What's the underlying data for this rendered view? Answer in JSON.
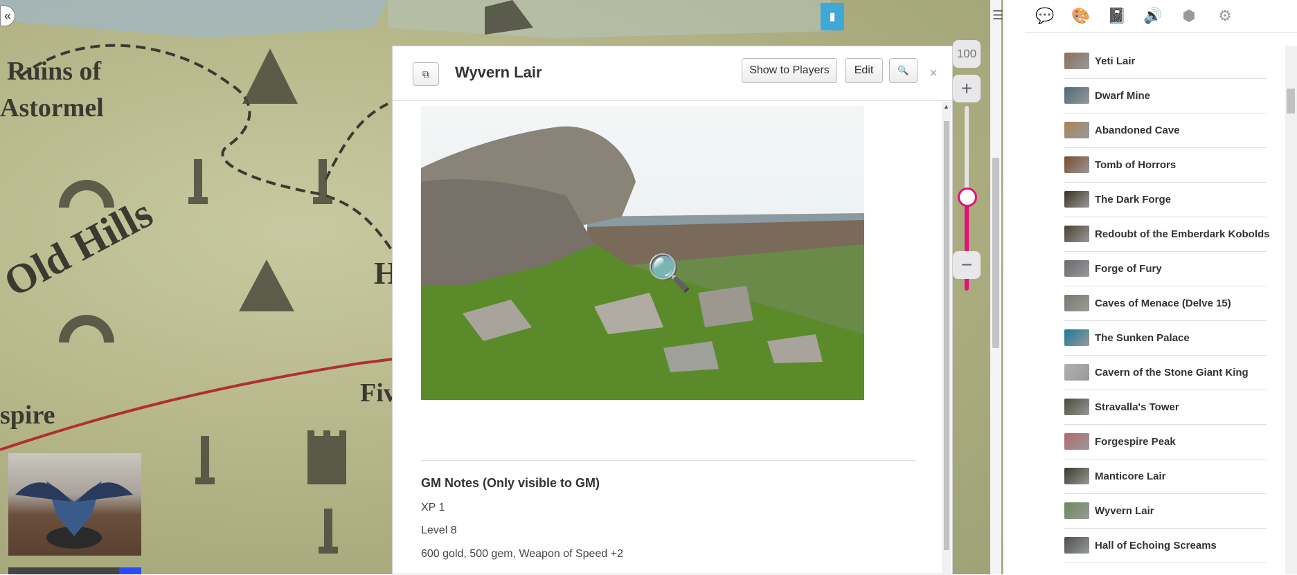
{
  "map": {
    "labels": [
      "Ruins of",
      "Astormel",
      "Old Hills",
      "spire",
      "Fiv",
      "H"
    ]
  },
  "zoom": {
    "value": "100",
    "level_fraction": 0.5
  },
  "dialog": {
    "title": "Wyvern Lair",
    "show_to_players": "Show to Players",
    "edit": "Edit",
    "search_glyph": "🔍",
    "close": "×",
    "gm_notes_heading": "GM Notes (Only visible to GM)",
    "gm_notes": [
      "XP 1",
      "Level 8",
      "600 gold, 500 gem, Weapon of Speed +2"
    ]
  },
  "panel": {
    "tabs": [
      {
        "icon": "chat-icon",
        "glyph": "💬"
      },
      {
        "icon": "art-library-icon",
        "glyph": "🎨"
      },
      {
        "icon": "journal-icon",
        "glyph": "📓"
      },
      {
        "icon": "jukebox-icon",
        "glyph": "🔊"
      },
      {
        "icon": "compendium-icon",
        "glyph": "⬢"
      },
      {
        "icon": "settings-icon",
        "glyph": "⚙"
      }
    ],
    "items": [
      {
        "label": "Yeti Lair",
        "color": "#8b6f5a"
      },
      {
        "label": "Dwarf Mine",
        "color": "#4a6a7a"
      },
      {
        "label": "Abandoned Cave",
        "color": "#a8845a"
      },
      {
        "label": "Tomb of Horrors",
        "color": "#7a4a2a"
      },
      {
        "label": "The Dark Forge",
        "color": "#3a3420"
      },
      {
        "label": "Redoubt of the Emberdark Kobolds",
        "color": "#4a4030"
      },
      {
        "label": "Forge of Fury",
        "color": "#6a6a70"
      },
      {
        "label": "Caves of Menace (Delve 15)",
        "color": "#7a7a70"
      },
      {
        "label": "The Sunken Palace",
        "color": "#1a7a9a"
      },
      {
        "label": "Cavern of the Stone Giant King",
        "color": "#b0b0b0"
      },
      {
        "label": "Stravalla's Tower",
        "color": "#4a4a3a"
      },
      {
        "label": "Forgespire Peak",
        "color": "#b06a6a"
      },
      {
        "label": "Manticore Lair",
        "color": "#3a3a2a"
      },
      {
        "label": "Wyvern Lair",
        "color": "#6a8a5a"
      },
      {
        "label": "Hall of Echoing Screams",
        "color": "#4a5050"
      }
    ]
  }
}
